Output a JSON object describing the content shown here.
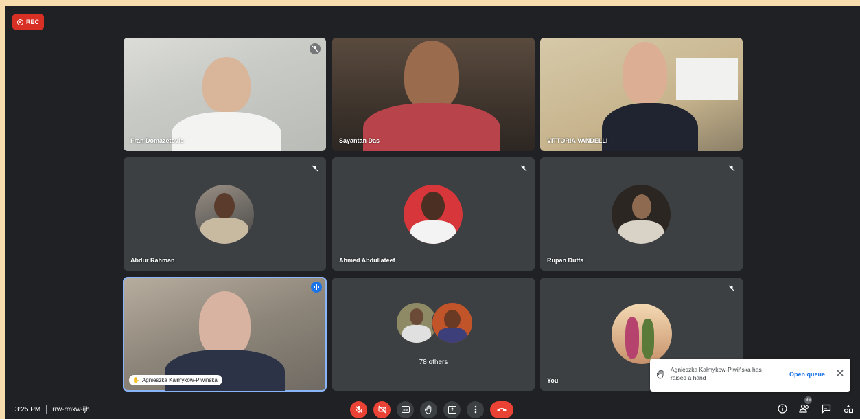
{
  "recording": {
    "label": "REC"
  },
  "meeting": {
    "time": "3:25 PM",
    "code": "rrw-rmxw-ijh"
  },
  "participants": [
    {
      "name": "Fran Domazetovic",
      "muted": true,
      "video": true
    },
    {
      "name": "Sayantan Das",
      "muted": false,
      "video": true
    },
    {
      "name": "VITTORIA VANDELLI",
      "muted": false,
      "video": true
    },
    {
      "name": "Abdur Rahman",
      "muted": true,
      "video": false
    },
    {
      "name": "Ahmed Abdullateef",
      "muted": true,
      "video": false
    },
    {
      "name": "Rupan Dutta",
      "muted": true,
      "video": false
    },
    {
      "name": "Agnieszka Kałmykow-Piwińska",
      "muted": false,
      "speaking": true,
      "video": true,
      "hand_raised": true
    },
    {
      "name": "78 others",
      "muted": false,
      "video": false
    },
    {
      "name": "You",
      "muted": true,
      "video": false
    }
  ],
  "toast": {
    "message": "Agnieszka Kałmykow-Piwińska has raised a hand",
    "action": "Open queue"
  },
  "people_count": "86",
  "colors": {
    "background": "#202124",
    "tile": "#3c4043",
    "danger": "#ea4335",
    "accent": "#1a73e8"
  }
}
